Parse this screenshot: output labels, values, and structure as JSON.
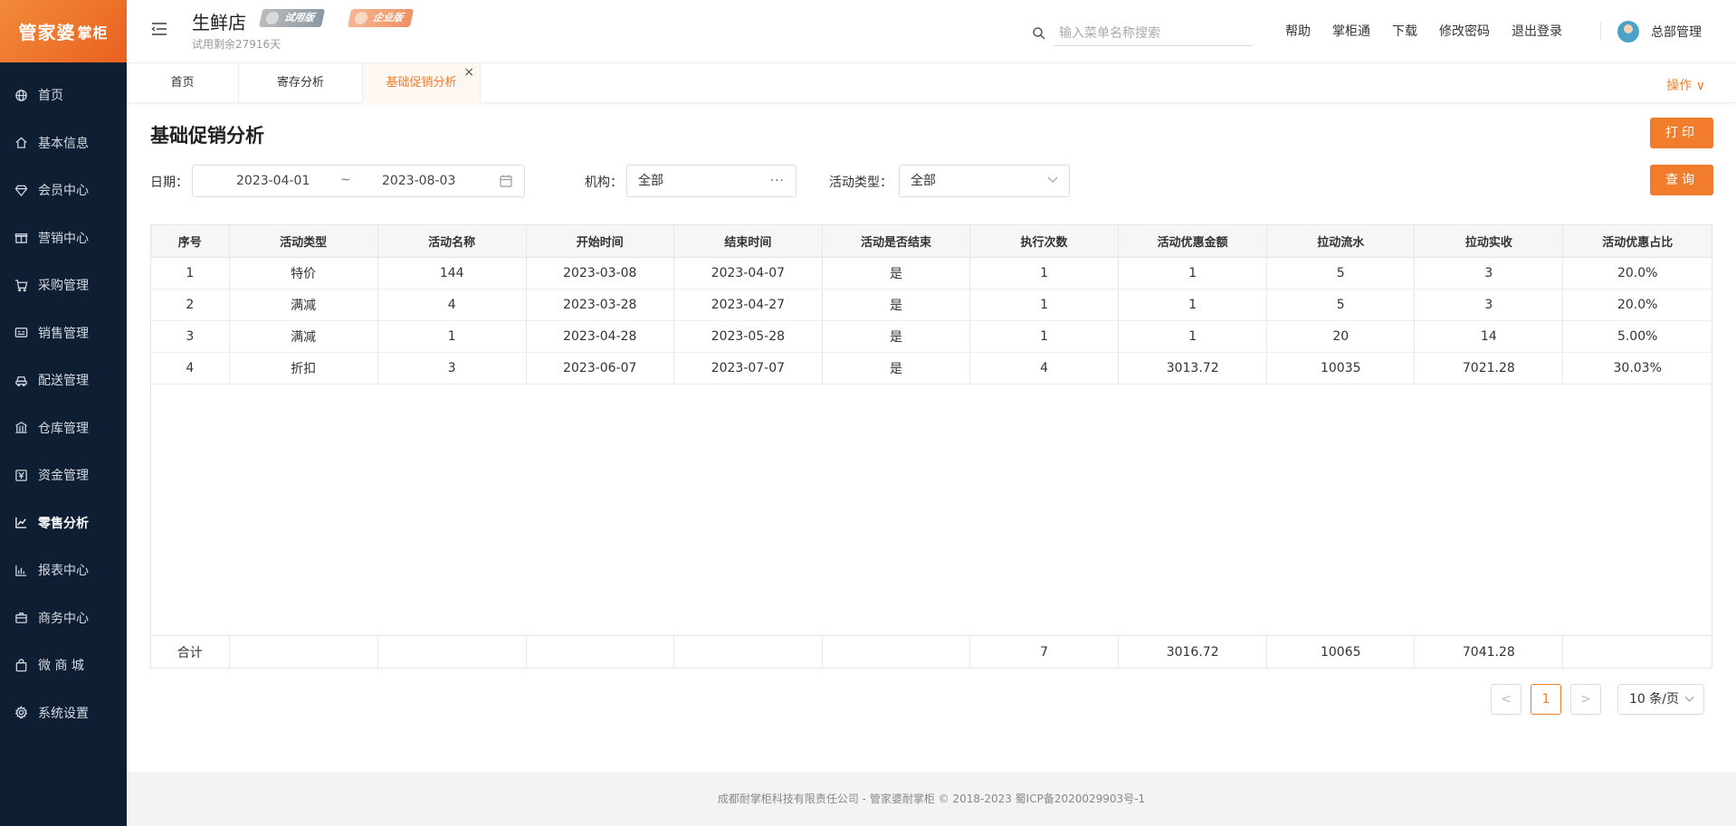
{
  "logo": {
    "text": "管家婆",
    "sub": "掌柜"
  },
  "sidebar": {
    "items": [
      {
        "label": "首页",
        "icon": "globe-icon"
      },
      {
        "label": "基本信息",
        "icon": "home-icon"
      },
      {
        "label": "会员中心",
        "icon": "diamond-icon"
      },
      {
        "label": "营销中心",
        "icon": "gift-icon"
      },
      {
        "label": "采购管理",
        "icon": "cart-icon"
      },
      {
        "label": "销售管理",
        "icon": "register-icon"
      },
      {
        "label": "配送管理",
        "icon": "car-icon"
      },
      {
        "label": "仓库管理",
        "icon": "warehouse-icon"
      },
      {
        "label": "资金管理",
        "icon": "yen-icon"
      },
      {
        "label": "零售分析",
        "icon": "line-chart-icon",
        "active": true
      },
      {
        "label": "报表中心",
        "icon": "bar-chart-icon"
      },
      {
        "label": "商务中心",
        "icon": "briefcase-icon"
      },
      {
        "label": "微 商 城",
        "icon": "bag-icon"
      },
      {
        "label": "系统设置",
        "icon": "gear-icon"
      }
    ]
  },
  "header": {
    "store_name": "生鲜店",
    "trial_left": "试用剩余27916天",
    "badge_trial": "试用版",
    "badge_enterprise": "企业版",
    "search_placeholder": "输入菜单名称搜索",
    "links": [
      "帮助",
      "掌柜通",
      "下载",
      "修改密码",
      "退出登录"
    ],
    "user": "总部管理"
  },
  "tabs": {
    "home": "首页",
    "deposit": "寄存分析",
    "promo": "基础促销分析",
    "close": "×",
    "ops": "操作 ∨"
  },
  "page": {
    "title": "基础促销分析",
    "print": "打印",
    "query": "查询"
  },
  "filters": {
    "date_label": "日期：",
    "date_start": "2023-04-01",
    "date_sep": "~",
    "date_end": "2023-08-03",
    "org_label": "机构：",
    "org_value": "全部",
    "org_more": "···",
    "type_label": "活动类型：",
    "type_value": "全部"
  },
  "table": {
    "headers": [
      "序号",
      "活动类型",
      "活动名称",
      "开始时间",
      "结束时间",
      "活动是否结束",
      "执行次数",
      "活动优惠金额",
      "拉动流水",
      "拉动实收",
      "活动优惠占比"
    ],
    "rows": [
      [
        "1",
        "特价",
        "144",
        "2023-03-08",
        "2023-04-07",
        "是",
        "1",
        "1",
        "5",
        "3",
        "20.0%"
      ],
      [
        "2",
        "满减",
        "4",
        "2023-03-28",
        "2023-04-27",
        "是",
        "1",
        "1",
        "5",
        "3",
        "20.0%"
      ],
      [
        "3",
        "满减",
        "1",
        "2023-04-28",
        "2023-05-28",
        "是",
        "1",
        "1",
        "20",
        "14",
        "5.00%"
      ],
      [
        "4",
        "折扣",
        "3",
        "2023-06-07",
        "2023-07-07",
        "是",
        "4",
        "3013.72",
        "10035",
        "7021.28",
        "30.03%"
      ]
    ],
    "totals": [
      "合计",
      "",
      "",
      "",
      "",
      "",
      "7",
      "3016.72",
      "10065",
      "7041.28",
      ""
    ]
  },
  "pagination": {
    "prev": "<",
    "current": "1",
    "next": ">",
    "page_size": "10 条/页"
  },
  "footer": {
    "text": "成都耐掌柜科技有限责任公司 - 管家婆耐掌柜 © 2018-2023 蜀ICP备2020029903号-1"
  },
  "colors": {
    "accent": "#f07c2c",
    "sidebar_bg": "#0f1f33"
  }
}
